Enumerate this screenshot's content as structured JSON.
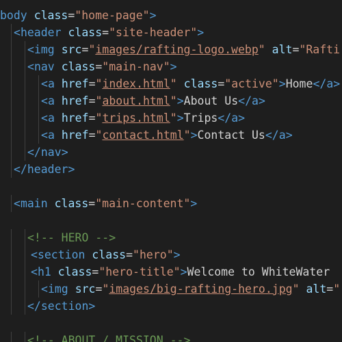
{
  "code": {
    "lines": [
      {
        "indent": 0,
        "tokens": [
          {
            "t": "tag",
            "v": "body"
          },
          {
            "t": "sp",
            "v": " "
          },
          {
            "t": "attr",
            "v": "class"
          },
          {
            "t": "eq",
            "v": "="
          },
          {
            "t": "str",
            "v": "\"home-page\""
          },
          {
            "t": "bracket",
            "v": ">"
          }
        ]
      },
      {
        "indent": 1,
        "tokens": [
          {
            "t": "bracket",
            "v": "<"
          },
          {
            "t": "tag",
            "v": "header"
          },
          {
            "t": "sp",
            "v": " "
          },
          {
            "t": "attr",
            "v": "class"
          },
          {
            "t": "eq",
            "v": "="
          },
          {
            "t": "str",
            "v": "\"site-header\""
          },
          {
            "t": "bracket",
            "v": ">"
          }
        ]
      },
      {
        "indent": 2,
        "tokens": [
          {
            "t": "bracket",
            "v": "<"
          },
          {
            "t": "tag",
            "v": "img"
          },
          {
            "t": "sp",
            "v": " "
          },
          {
            "t": "attr",
            "v": "src"
          },
          {
            "t": "eq",
            "v": "="
          },
          {
            "t": "str",
            "v": "\""
          },
          {
            "t": "link",
            "v": "images/rafting-logo.webp"
          },
          {
            "t": "str",
            "v": "\""
          },
          {
            "t": "sp",
            "v": " "
          },
          {
            "t": "attr",
            "v": "alt"
          },
          {
            "t": "eq",
            "v": "="
          },
          {
            "t": "str",
            "v": "\"Rafti"
          }
        ]
      },
      {
        "indent": 2,
        "tokens": [
          {
            "t": "bracket",
            "v": "<"
          },
          {
            "t": "tag",
            "v": "nav"
          },
          {
            "t": "sp",
            "v": " "
          },
          {
            "t": "attr",
            "v": "class"
          },
          {
            "t": "eq",
            "v": "="
          },
          {
            "t": "str",
            "v": "\"main-nav\""
          },
          {
            "t": "bracket",
            "v": ">"
          }
        ]
      },
      {
        "indent": 3,
        "tokens": [
          {
            "t": "bracket",
            "v": "<"
          },
          {
            "t": "tag",
            "v": "a"
          },
          {
            "t": "sp",
            "v": " "
          },
          {
            "t": "attr",
            "v": "href"
          },
          {
            "t": "eq",
            "v": "="
          },
          {
            "t": "str",
            "v": "\""
          },
          {
            "t": "link",
            "v": "index.html"
          },
          {
            "t": "str",
            "v": "\""
          },
          {
            "t": "sp",
            "v": " "
          },
          {
            "t": "attr",
            "v": "class"
          },
          {
            "t": "eq",
            "v": "="
          },
          {
            "t": "str",
            "v": "\"active\""
          },
          {
            "t": "bracket",
            "v": ">"
          },
          {
            "t": "text",
            "v": "Home"
          },
          {
            "t": "bracket",
            "v": "</"
          },
          {
            "t": "tag",
            "v": "a"
          },
          {
            "t": "bracket",
            "v": ">"
          }
        ]
      },
      {
        "indent": 3,
        "tokens": [
          {
            "t": "bracket",
            "v": "<"
          },
          {
            "t": "tag",
            "v": "a"
          },
          {
            "t": "sp",
            "v": " "
          },
          {
            "t": "attr",
            "v": "href"
          },
          {
            "t": "eq",
            "v": "="
          },
          {
            "t": "str",
            "v": "\""
          },
          {
            "t": "link",
            "v": "about.html"
          },
          {
            "t": "str",
            "v": "\""
          },
          {
            "t": "bracket",
            "v": ">"
          },
          {
            "t": "text",
            "v": "About Us"
          },
          {
            "t": "bracket",
            "v": "</"
          },
          {
            "t": "tag",
            "v": "a"
          },
          {
            "t": "bracket",
            "v": ">"
          }
        ]
      },
      {
        "indent": 3,
        "tokens": [
          {
            "t": "bracket",
            "v": "<"
          },
          {
            "t": "tag",
            "v": "a"
          },
          {
            "t": "sp",
            "v": " "
          },
          {
            "t": "attr",
            "v": "href"
          },
          {
            "t": "eq",
            "v": "="
          },
          {
            "t": "str",
            "v": "\""
          },
          {
            "t": "link",
            "v": "trips.html"
          },
          {
            "t": "str",
            "v": "\""
          },
          {
            "t": "bracket",
            "v": ">"
          },
          {
            "t": "text",
            "v": "Trips"
          },
          {
            "t": "bracket",
            "v": "</"
          },
          {
            "t": "tag",
            "v": "a"
          },
          {
            "t": "bracket",
            "v": ">"
          }
        ]
      },
      {
        "indent": 3,
        "tokens": [
          {
            "t": "bracket",
            "v": "<"
          },
          {
            "t": "tag",
            "v": "a"
          },
          {
            "t": "sp",
            "v": " "
          },
          {
            "t": "attr",
            "v": "href"
          },
          {
            "t": "eq",
            "v": "="
          },
          {
            "t": "str",
            "v": "\""
          },
          {
            "t": "link",
            "v": "contact.html"
          },
          {
            "t": "str",
            "v": "\""
          },
          {
            "t": "bracket",
            "v": ">"
          },
          {
            "t": "text",
            "v": "Contact Us"
          },
          {
            "t": "bracket",
            "v": "</"
          },
          {
            "t": "tag",
            "v": "a"
          },
          {
            "t": "bracket",
            "v": ">"
          }
        ]
      },
      {
        "indent": 2,
        "tokens": [
          {
            "t": "bracket",
            "v": "</"
          },
          {
            "t": "tag",
            "v": "nav"
          },
          {
            "t": "bracket",
            "v": ">"
          }
        ]
      },
      {
        "indent": 1,
        "tokens": [
          {
            "t": "bracket",
            "v": "</"
          },
          {
            "t": "tag",
            "v": "header"
          },
          {
            "t": "bracket",
            "v": ">"
          }
        ]
      },
      {
        "indent": 0,
        "tokens": []
      },
      {
        "indent": 1,
        "tokens": [
          {
            "t": "bracket",
            "v": "<"
          },
          {
            "t": "tag",
            "v": "main"
          },
          {
            "t": "sp",
            "v": " "
          },
          {
            "t": "attr",
            "v": "class"
          },
          {
            "t": "eq",
            "v": "="
          },
          {
            "t": "str",
            "v": "\"main-content\""
          },
          {
            "t": "bracket",
            "v": ">"
          }
        ]
      },
      {
        "indent": 0,
        "tokens": []
      },
      {
        "indent": 2,
        "tokens": [
          {
            "t": "comment",
            "v": "<!-- HERO -->"
          }
        ]
      },
      {
        "indent": 2,
        "offset": 1,
        "tokens": [
          {
            "t": "bracket",
            "v": "<"
          },
          {
            "t": "tag",
            "v": "section"
          },
          {
            "t": "sp",
            "v": " "
          },
          {
            "t": "attr",
            "v": "class"
          },
          {
            "t": "eq",
            "v": "="
          },
          {
            "t": "str",
            "v": "\"hero\""
          },
          {
            "t": "bracket",
            "v": ">"
          }
        ]
      },
      {
        "indent": 2,
        "offset": 1,
        "tokens": [
          {
            "t": "bracket",
            "v": "<"
          },
          {
            "t": "tag",
            "v": "h1"
          },
          {
            "t": "sp",
            "v": " "
          },
          {
            "t": "attr",
            "v": "class"
          },
          {
            "t": "eq",
            "v": "="
          },
          {
            "t": "str",
            "v": "\"hero-title\""
          },
          {
            "t": "bracket",
            "v": ">"
          },
          {
            "t": "text",
            "v": "Welcome to WhiteWater"
          }
        ]
      },
      {
        "indent": 3,
        "tokens": [
          {
            "t": "bracket",
            "v": "<"
          },
          {
            "t": "tag",
            "v": "img"
          },
          {
            "t": "sp",
            "v": " "
          },
          {
            "t": "attr",
            "v": "src"
          },
          {
            "t": "eq",
            "v": "="
          },
          {
            "t": "str",
            "v": "\""
          },
          {
            "t": "link",
            "v": "images/big-rafting-hero.jpg"
          },
          {
            "t": "str",
            "v": "\""
          },
          {
            "t": "sp",
            "v": " "
          },
          {
            "t": "attr",
            "v": "alt"
          },
          {
            "t": "eq",
            "v": "="
          },
          {
            "t": "str",
            "v": "\""
          }
        ]
      },
      {
        "indent": 2,
        "tokens": [
          {
            "t": "bracket",
            "v": "</"
          },
          {
            "t": "tag",
            "v": "section"
          },
          {
            "t": "bracket",
            "v": ">"
          }
        ]
      },
      {
        "indent": 0,
        "tokens": []
      },
      {
        "indent": 2,
        "tokens": [
          {
            "t": "comment",
            "v": "<!-- ABOUT / MISSION -->"
          }
        ]
      }
    ]
  }
}
